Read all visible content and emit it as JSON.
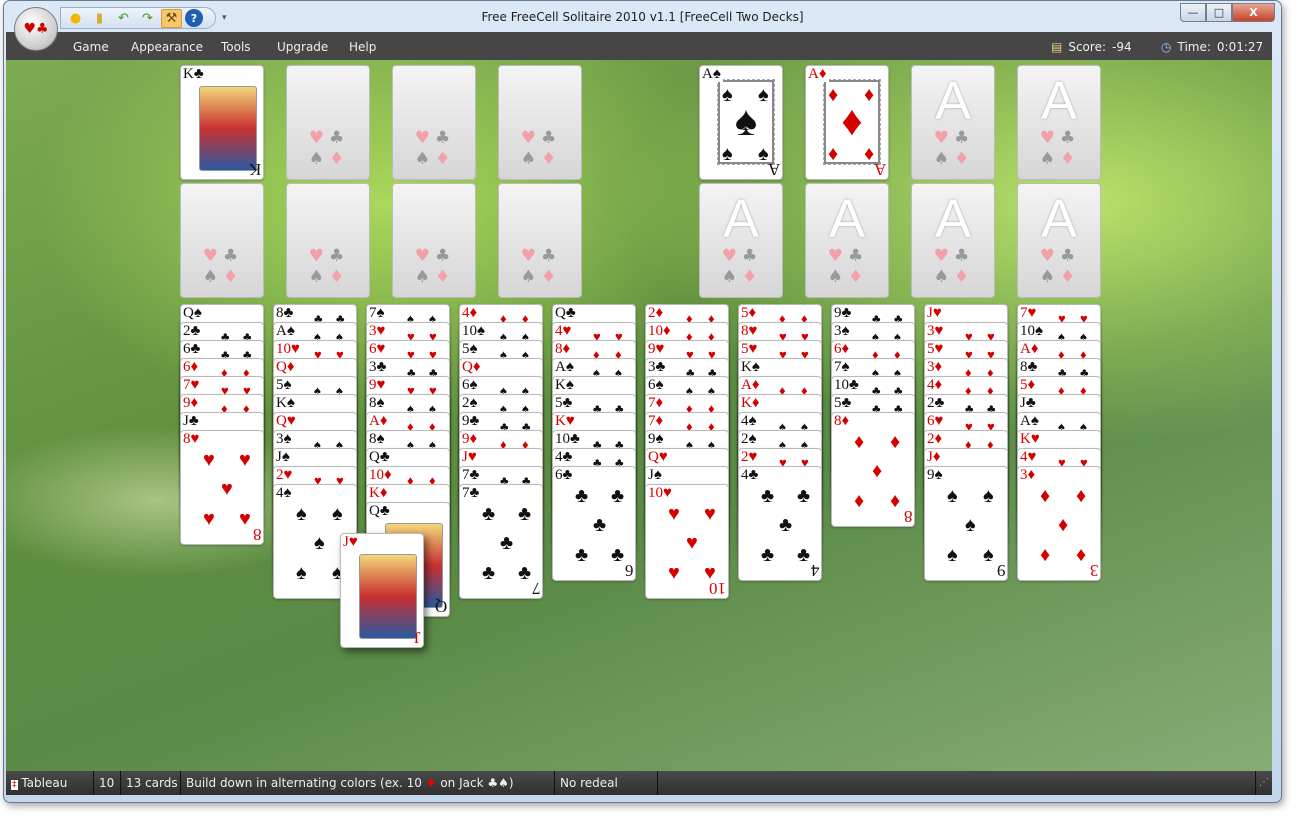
{
  "window": {
    "title": "Free FreeCell Solitaire 2010 v1.1  [FreeCell Two Decks]",
    "quick_access": [
      "new-game-icon",
      "open-icon",
      "undo-icon",
      "redo-icon",
      "hint-icon",
      "help-icon"
    ],
    "controls": {
      "minimize": "—",
      "maximize": "□",
      "close": "X"
    }
  },
  "menu": {
    "items": [
      "Game",
      "Appearance",
      "Tools",
      "Upgrade",
      "Help"
    ],
    "score_label": "Score:",
    "score": "-94",
    "time_label": "Time:",
    "time": "0:01:27"
  },
  "colors": {
    "red": "#d40000",
    "black": "#111111",
    "menubar": "#464646"
  },
  "freecells": [
    "K♣",
    null,
    null,
    null,
    null,
    null,
    null,
    null
  ],
  "foundations": [
    "A♠",
    "A♦",
    null,
    null,
    null,
    null,
    null,
    null
  ],
  "empty_foundation_label": "A",
  "tableau": [
    [
      "Q♠",
      "2♣",
      "6♣",
      "6♦",
      "7♥",
      "9♦",
      "J♣",
      "8♥"
    ],
    [
      "8♣",
      "A♠",
      "10♥",
      "Q♦",
      "5♠",
      "K♠",
      "Q♥",
      "3♠",
      "J♠",
      "2♥",
      "4♠"
    ],
    [
      "7♠",
      "3♥",
      "6♥",
      "3♣",
      "9♥",
      "8♠",
      "A♦",
      "8♠",
      "Q♣",
      "10♦",
      "K♦",
      "Q♣"
    ],
    [
      "4♦",
      "10♠",
      "5♠",
      "Q♦",
      "6♠",
      "2♠",
      "9♣",
      "9♦",
      "J♥",
      "7♣",
      "7♣"
    ],
    [
      "Q♣",
      "4♥",
      "8♦",
      "A♠",
      "K♠",
      "5♣",
      "K♥",
      "10♣",
      "4♣",
      "6♣"
    ],
    [
      "2♦",
      "10♦",
      "9♥",
      "3♣",
      "6♠",
      "7♦",
      "7♦",
      "9♠",
      "Q♥",
      "J♠",
      "10♥"
    ],
    [
      "5♦",
      "8♥",
      "5♥",
      "K♠",
      "A♦",
      "K♦",
      "4♠",
      "2♠",
      "2♥",
      "4♣"
    ],
    [
      "9♣",
      "3♠",
      "6♦",
      "7♠",
      "10♣",
      "5♣",
      "8♦"
    ],
    [
      "J♥",
      "3♥",
      "5♥",
      "3♦",
      "4♦",
      "2♣",
      "6♥",
      "2♦",
      "J♦",
      "9♠"
    ],
    [
      "7♥",
      "10♠",
      "A♦",
      "8♣",
      "5♦",
      "J♣",
      "A♠",
      "K♥",
      "4♥",
      "3♦"
    ]
  ],
  "dragged_card": "J♥",
  "status": {
    "area": "Tableau",
    "count": "10",
    "cards": "13 cards",
    "rule_prefix": "Build down in alternating colors (ex. 10",
    "rule_suit": "♦",
    "rule_suffix": "on Jack ♣♠)",
    "redeal": "No redeal"
  }
}
